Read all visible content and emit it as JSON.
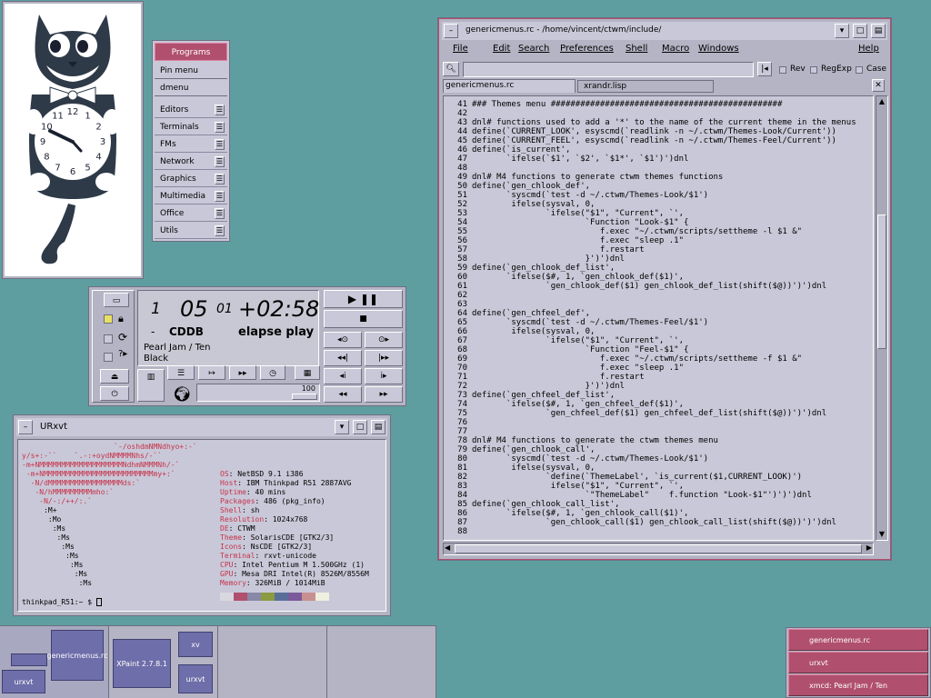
{
  "menu": {
    "title": "Programs",
    "items": [
      "Pin menu",
      "dmenu",
      "Editors",
      "Terminals",
      "FMs",
      "Network",
      "Graphics",
      "Multimedia",
      "Office",
      "Utils"
    ]
  },
  "catclock": {
    "numbers": [
      "12",
      "1",
      "2",
      "3",
      "4",
      "5",
      "6",
      "7",
      "8",
      "9",
      "10",
      "11"
    ]
  },
  "cdplayer": {
    "track_small": "1",
    "track": "05",
    "index_small": "01",
    "time": "+02:58",
    "dash": "-",
    "source": "CDDB",
    "mode": "elapse play",
    "artist_title": "Pearl Jam / Ten",
    "song": "Black",
    "volume": "100"
  },
  "terminal": {
    "title": "URxvt",
    "logo_lines": [
      "                     `-/oshdmNMNdhyo+:-`",
      "y/s+:-``    `.-:+oydNMMMMNhs/-``",
      "-m+NMMMMMMMMMMMMMMMMMMMNdhmNMMMNh/-`",
      " -m+NMMMMMMMMMMMMMMMMMMMMMMMMMmy+:`",
      "  -N/dMMMMMMMMMMMMMMMMMds:`",
      "   -N/hMMMMMMMMMmho:`",
      "    -N/-:/++/:.`",
      "     :M+",
      "      :Mo",
      "       :Ms",
      "        :Ms",
      "         :Ms",
      "          :Ms",
      "           :Ms",
      "            :Ms",
      "             :Ms"
    ],
    "info": [
      {
        "k": "OS",
        "v": "NetBSD 9.1 i386"
      },
      {
        "k": "Host",
        "v": "IBM Thinkpad R51 2887AVG"
      },
      {
        "k": "Uptime",
        "v": "40 mins"
      },
      {
        "k": "Packages",
        "v": "486 (pkg_info)"
      },
      {
        "k": "Shell",
        "v": "sh"
      },
      {
        "k": "Resolution",
        "v": "1024x768"
      },
      {
        "k": "DE",
        "v": "CTWM"
      },
      {
        "k": "Theme",
        "v": "SolarisCDE [GTK2/3]"
      },
      {
        "k": "Icons",
        "v": "NsCDE [GTK2/3]"
      },
      {
        "k": "Terminal",
        "v": "rxvt-unicode"
      },
      {
        "k": "CPU",
        "v": "Intel Pentium M 1.500GHz (1)"
      },
      {
        "k": "GPU",
        "v": "Mesa DRI Intel(R) 8526M/8556M"
      },
      {
        "k": "Memory",
        "v": "326MiB / 1014MiB"
      }
    ],
    "swatches": [
      "#d8d8e0",
      "#b0506e",
      "#8888a8",
      "#8c9a40",
      "#5a6e9a",
      "#7a5a9a",
      "#c89090",
      "#f0f0e0"
    ],
    "prompt": "thinkpad_R51:~ $"
  },
  "editor": {
    "title": "genericmenus.rc - /home/vincent/ctwm/include/",
    "menus": [
      "File",
      "Edit",
      "Search",
      "Preferences",
      "Shell",
      "Macro",
      "Windows",
      "Help"
    ],
    "search": {
      "rev": "Rev",
      "regexp": "RegExp",
      "case": "Case"
    },
    "tabs": [
      "genericmenus.rc",
      "xrandr.lisp"
    ],
    "lines": [
      {
        "n": "41",
        "t": "### Themes menu ###############################################"
      },
      {
        "n": "42",
        "t": ""
      },
      {
        "n": "43",
        "t": "dnl# functions used to add a '*' to the name of the current theme in the menus"
      },
      {
        "n": "44",
        "t": "define(`CURRENT_LOOK', esyscmd(`readlink -n ~/.ctwm/Themes-Look/Current'))"
      },
      {
        "n": "45",
        "t": "define(`CURRENT_FEEL', esyscmd(`readlink -n ~/.ctwm/Themes-Feel/Current'))"
      },
      {
        "n": "46",
        "t": "define(`is_current',"
      },
      {
        "n": "47",
        "t": "       `ifelse(`$1', `$2', `$1*', `$1')')dnl"
      },
      {
        "n": "48",
        "t": ""
      },
      {
        "n": "49",
        "t": "dnl# M4 functions to generate ctwm themes functions"
      },
      {
        "n": "50",
        "t": "define(`gen_chlook_def',"
      },
      {
        "n": "51",
        "t": "       `syscmd(`test -d ~/.ctwm/Themes-Look/$1')"
      },
      {
        "n": "52",
        "t": "        ifelse(sysval, 0,"
      },
      {
        "n": "53",
        "t": "               `ifelse(\"$1\", \"Current\", `',"
      },
      {
        "n": "54",
        "t": "                       `Function \"Look-$1\" {"
      },
      {
        "n": "55",
        "t": "                          f.exec \"~/.ctwm/scripts/settheme -l $1 &\""
      },
      {
        "n": "56",
        "t": "                          f.exec \"sleep .1\""
      },
      {
        "n": "57",
        "t": "                          f.restart"
      },
      {
        "n": "58",
        "t": "                       }')')dnl"
      },
      {
        "n": "59",
        "t": "define(`gen_chlook_def_list',"
      },
      {
        "n": "60",
        "t": "       `ifelse($#, 1, `gen_chlook_def($1)',"
      },
      {
        "n": "61",
        "t": "               `gen_chlook_def($1) gen_chlook_def_list(shift($@))')')dnl"
      },
      {
        "n": "62",
        "t": ""
      },
      {
        "n": "63",
        "t": ""
      },
      {
        "n": "64",
        "t": "define(`gen_chfeel_def',"
      },
      {
        "n": "65",
        "t": "       `syscmd(`test -d ~/.ctwm/Themes-Feel/$1')"
      },
      {
        "n": "66",
        "t": "        ifelse(sysval, 0,"
      },
      {
        "n": "67",
        "t": "               `ifelse(\"$1\", \"Current\", `',"
      },
      {
        "n": "68",
        "t": "                       `Function \"Feel-$1\" {"
      },
      {
        "n": "69",
        "t": "                          f.exec \"~/.ctwm/scripts/settheme -f $1 &\""
      },
      {
        "n": "70",
        "t": "                          f.exec \"sleep .1\""
      },
      {
        "n": "71",
        "t": "                          f.restart"
      },
      {
        "n": "72",
        "t": "                       }')')dnl"
      },
      {
        "n": "73",
        "t": "define(`gen_chfeel_def_list',"
      },
      {
        "n": "74",
        "t": "       `ifelse($#, 1, `gen_chfeel_def($1)',"
      },
      {
        "n": "75",
        "t": "               `gen_chfeel_def($1) gen_chfeel_def_list(shift($@))')')dnl"
      },
      {
        "n": "76",
        "t": ""
      },
      {
        "n": "77",
        "t": ""
      },
      {
        "n": "78",
        "t": "dnl# M4 functions to generate the ctwm themes menu"
      },
      {
        "n": "79",
        "t": "define(`gen_chlook_call',"
      },
      {
        "n": "80",
        "t": "       `syscmd(`test -d ~/.ctwm/Themes-Look/$1')"
      },
      {
        "n": "81",
        "t": "        ifelse(sysval, 0,"
      },
      {
        "n": "82",
        "t": "               `define(`ThemeLabel', `is_current($1,CURRENT_LOOK)')"
      },
      {
        "n": "83",
        "t": "                ifelse(\"$1\", \"Current\", `',"
      },
      {
        "n": "84",
        "t": "                       `\"ThemeLabel\"    f.function \"Look-$1\"')')')dnl"
      },
      {
        "n": "85",
        "t": "define(`gen_chlook_call_list',"
      },
      {
        "n": "86",
        "t": "       `ifelse($#, 1, `gen_chlook_call($1)',"
      },
      {
        "n": "87",
        "t": "               `gen_chlook_call($1) gen_chlook_call_list(shift($@))')')dnl"
      },
      {
        "n": "88",
        "t": ""
      }
    ]
  },
  "pager": {
    "desk1": {
      "win1": "genericmenus.rc",
      "win2": "urxvt"
    },
    "desk2": {
      "win1": "XPaint 2.7.8.1",
      "win2": "xv",
      "win3": "urxvt"
    }
  },
  "iconmgr": [
    "genericmenus.rc",
    "urxvt",
    "xmcd: Pearl Jam / Ten"
  ]
}
